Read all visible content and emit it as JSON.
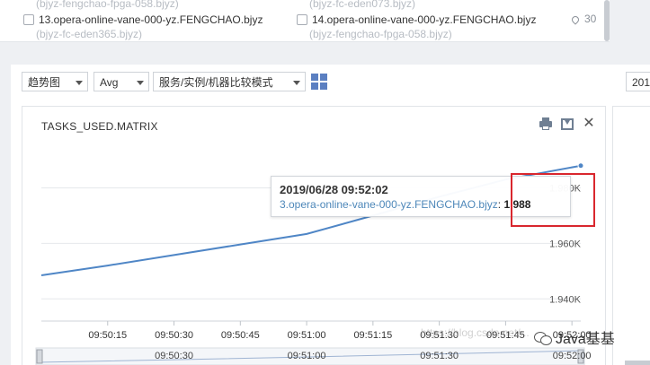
{
  "top_list": {
    "faded_items": [
      "(bjyz-fengchao-fpga-058.bjyz)",
      "(bjyz-fc-eden073.bjyz)"
    ],
    "items": [
      {
        "label": "13.opera-online-vane-000-yz.FENGCHAO.bjyz",
        "sub": "(bjyz-fc-eden365.bjyz)"
      },
      {
        "label": "14.opera-online-vane-000-yz.FENGCHAO.bjyz",
        "sub": "(bjyz-fengchao-fpga-058.bjyz)"
      }
    ],
    "count": "30"
  },
  "toolbar": {
    "chart_type": "趋势图",
    "aggregation": "Avg",
    "compare_mode": "服务/实例/机器比较模式",
    "right_select": "201"
  },
  "card": {
    "title": "TASKS_USED.MATRIX"
  },
  "tooltip": {
    "time": "2019/06/28 09:52:02",
    "series": "3.opera-online-vane-000-yz.FENGCHAO.bjyz",
    "value": "1,988"
  },
  "overlay": {
    "watermark": "https://blog.csdn.net/...",
    "wechat": "Java基基"
  },
  "colors": {
    "line": "#4f86c6",
    "highlight": "#d9272e",
    "accent": "#5b7fc1"
  },
  "chart_data": {
    "type": "line",
    "title": "TASKS_USED.MATRIX",
    "x": [
      "09:50:00",
      "09:50:15",
      "09:50:30",
      "09:50:45",
      "09:51:00",
      "09:51:15",
      "09:51:30",
      "09:51:45",
      "09:52:02"
    ],
    "x_tick_labels": [
      "09:50:15",
      "09:50:30",
      "09:50:45",
      "09:51:00",
      "09:51:15",
      "09:51:30",
      "09:51:45",
      "09:52:00"
    ],
    "series": [
      {
        "name": "3.opera-online-vane-000-yz.FENGCHAO.bjyz",
        "values": [
          1948.5,
          1952.0,
          1955.8,
          1959.6,
          1963.4,
          1970.0,
          1976.8,
          1983.0,
          1988.0
        ]
      }
    ],
    "y_tick_labels": [
      "1.940K",
      "1.960K",
      "1.980K"
    ],
    "y_ticks": [
      1940,
      1960,
      1980
    ],
    "ylim": [
      1932,
      1996
    ],
    "navigator_labels": [
      "09:50:30",
      "09:51:00",
      "09:51:30",
      "09:52:00"
    ],
    "grid": true
  }
}
